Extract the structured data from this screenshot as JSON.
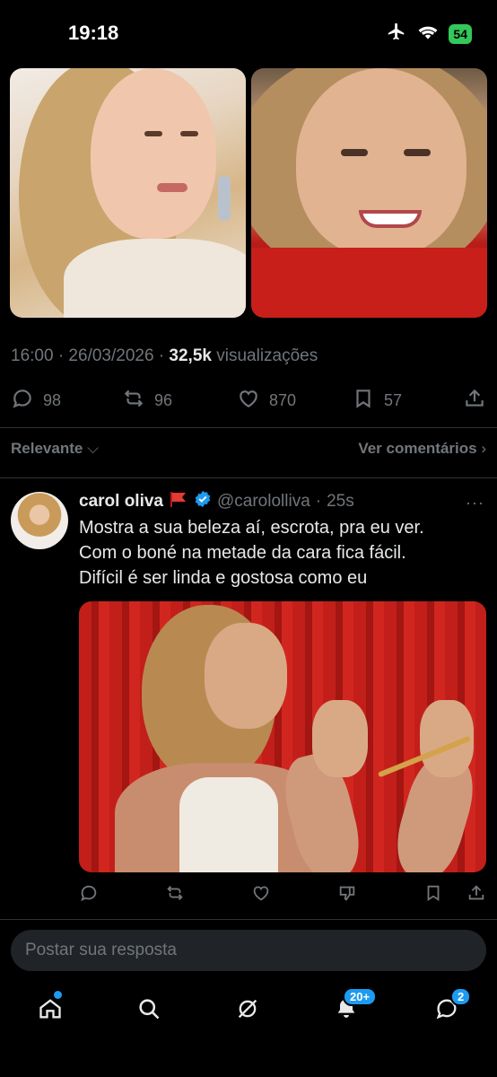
{
  "status_bar": {
    "time": "19:18",
    "battery": "54"
  },
  "post": {
    "timestamp": "16:00 · 26/03/2026 · ",
    "views_count": "32,5k",
    "views_label": " visualizações",
    "stats": {
      "replies": "98",
      "reposts": "96",
      "likes": "870",
      "bookmarks": "57"
    }
  },
  "filters": {
    "sort": "Relevante",
    "view_comments": "Ver comentários"
  },
  "reply": {
    "name": "carol oliva",
    "handle": "@carololliva",
    "time": "25s",
    "more": "···",
    "text_lines": [
      "Mostra a sua beleza aí, escrota, pra eu ver.",
      "Com o boné na metade da cara fica fácil.",
      "Difícil é ser linda e gostosa como eu"
    ]
  },
  "composer": {
    "placeholder": "Postar sua resposta"
  },
  "nav": {
    "notifications_badge": "20+",
    "messages_badge": "2"
  },
  "colors": {
    "accent": "#1d9bf0",
    "muted": "#71767b",
    "text": "#e7e9ea",
    "divider": "#2f3336"
  }
}
